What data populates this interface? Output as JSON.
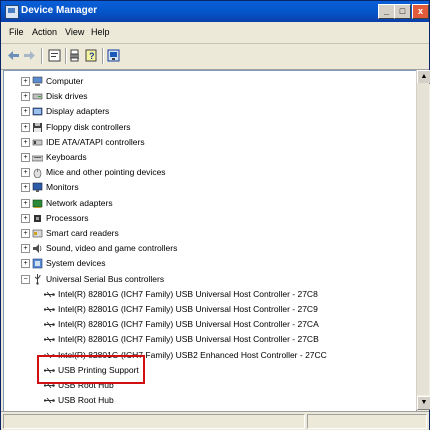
{
  "window": {
    "title": "Device Manager"
  },
  "menu": [
    "File",
    "Action",
    "View",
    "Help"
  ],
  "toolbar": {
    "icons": [
      "back-arrow-icon",
      "forward-arrow-icon",
      "properties-icon",
      "print-icon",
      "help-icon",
      "scan-hardware-icon"
    ]
  },
  "tree": {
    "categories": [
      {
        "label": "Computer",
        "icon": "computer-icon"
      },
      {
        "label": "Disk drives",
        "icon": "disk-drive-icon"
      },
      {
        "label": "Display adapters",
        "icon": "display-adapter-icon"
      },
      {
        "label": "Floppy disk controllers",
        "icon": "floppy-controller-icon"
      },
      {
        "label": "IDE ATA/ATAPI controllers",
        "icon": "ide-controller-icon"
      },
      {
        "label": "Keyboards",
        "icon": "keyboard-icon"
      },
      {
        "label": "Mice and other pointing devices",
        "icon": "mouse-icon"
      },
      {
        "label": "Monitors",
        "icon": "monitor-icon"
      },
      {
        "label": "Network adapters",
        "icon": "network-adapter-icon"
      },
      {
        "label": "Processors",
        "icon": "processor-icon"
      },
      {
        "label": "Smart card readers",
        "icon": "smart-card-icon"
      },
      {
        "label": "Sound, video and game controllers",
        "icon": "sound-icon"
      },
      {
        "label": "System devices",
        "icon": "system-device-icon"
      },
      {
        "label": "Universal Serial Bus controllers",
        "icon": "usb-icon"
      }
    ],
    "usb_children": [
      "Intel(R) 82801G (ICH7 Family) USB Universal Host Controller - 27C8",
      "Intel(R) 82801G (ICH7 Family) USB Universal Host Controller - 27C9",
      "Intel(R) 82801G (ICH7 Family) USB Universal Host Controller - 27CA",
      "Intel(R) 82801G (ICH7 Family) USB Universal Host Controller - 27CB",
      "Intel(R) 82801G (ICH7 Family) USB2 Enhanced Host Controller - 27CC",
      "USB Printing Support",
      "USB Root Hub",
      "USB Root Hub"
    ]
  },
  "colors": {
    "title_bar": "#0454c8",
    "highlight_box": "#d01010"
  }
}
